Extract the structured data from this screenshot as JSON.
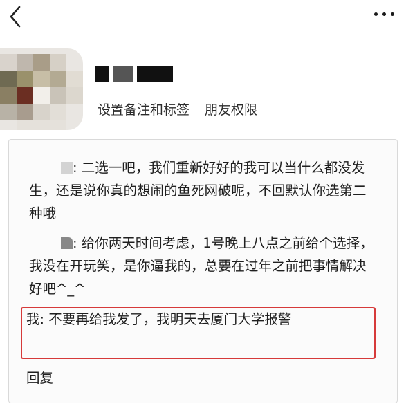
{
  "nav": {
    "back_icon": "chevron-left-icon",
    "more_icon": "ellipsis-icon"
  },
  "profile": {
    "set_remark_label": "设置备注和标签",
    "permissions_label": "朋友权限"
  },
  "messages": [
    {
      "sender": ":",
      "text": " 二选一吧，我们重新好好的我可以当什么都没发生，还是说你真的想闹的鱼死网破呢，不回默认你选第二种哦"
    },
    {
      "sender": ":",
      "text": " 给你两天时间考虑，1号晚上八点之前给个选择，我没在开玩笑，是你逼我的，总要在过年之前把事情解决好吧^_^"
    },
    {
      "sender": "我:",
      "text": " 不要再给我发了，我明天去厦门大学报警"
    }
  ],
  "reply_label": "回复",
  "colors": {
    "highlight": "#d63a3a"
  }
}
